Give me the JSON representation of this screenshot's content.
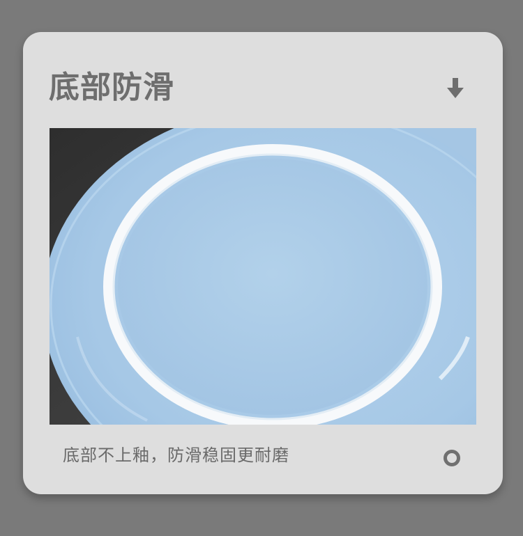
{
  "card": {
    "title": "底部防滑",
    "caption": "底部不上釉，防滑稳固更耐磨",
    "icons": {
      "top_right": "down-arrow-icon",
      "bottom_right": "ring-icon"
    }
  },
  "photo": {
    "subject": "plate-bottom-photo",
    "colors": {
      "plate": "#a9cbe8",
      "rim": "#ffffff",
      "background": "#3b3b3b"
    }
  }
}
